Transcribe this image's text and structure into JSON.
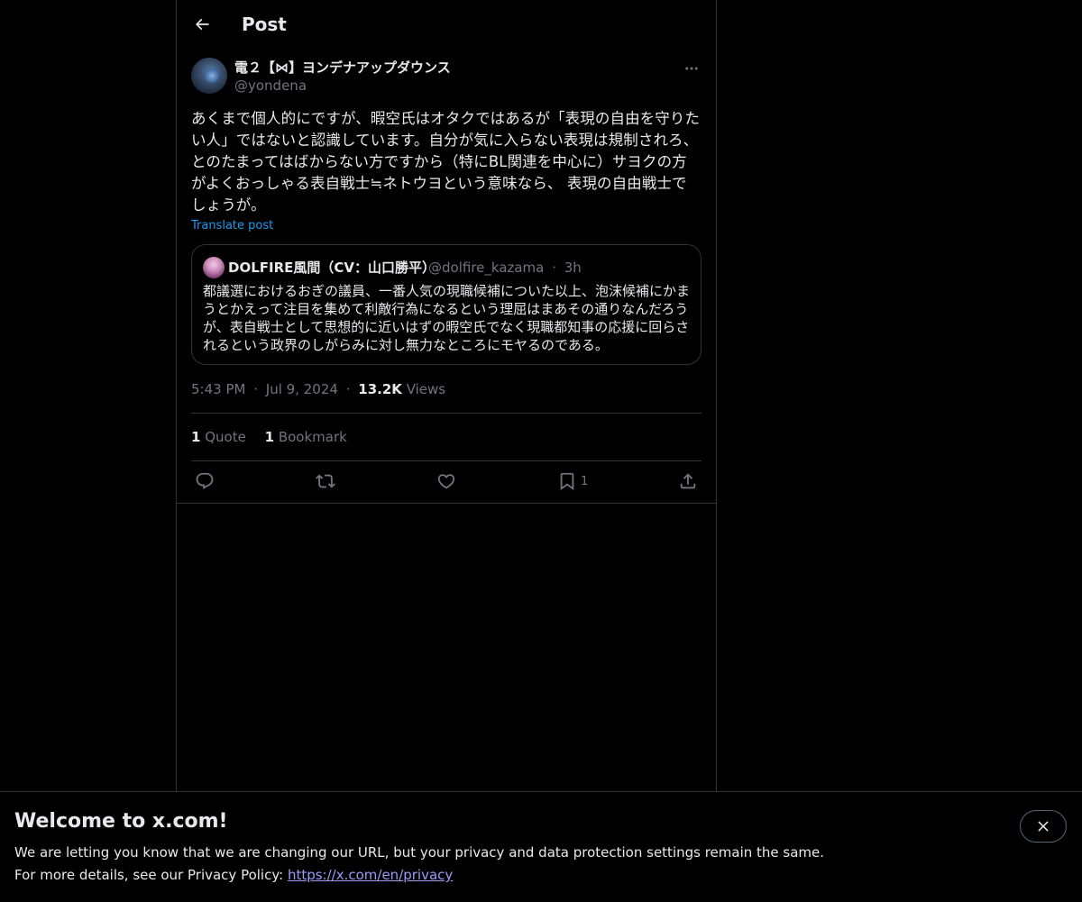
{
  "header": {
    "title": "Post"
  },
  "post": {
    "author_name": "電２【⋈】ヨンデナアップダウンス",
    "author_handle": "@yondena",
    "text": "あくまで個人的にですが、暇空氏はオタクではあるが「表現の自由を守りたい人」ではないと認識しています。自分が気に入らない表現は規制されろ、とのたまってはばからない方ですから（特にBL関連を中心に）サヨクの方がよくおっしゃる表自戦士≒ネトウヨという意味なら、 表現の自由戦士でしょうが。",
    "translate_label": "Translate post",
    "time": "5:43 PM",
    "date": "Jul 9, 2024",
    "views_count": "13.2K",
    "views_label": "Views",
    "dot": "·"
  },
  "quote": {
    "author_name": "DOLFIRE風間（CV：山口勝平）",
    "author_handle": "@dolfire_kazama",
    "age": "3h",
    "dot": "·",
    "text": "都議選におけるおぎの議員、一番人気の現職候補についた以上、泡沫候補にかまうとかえって注目を集めて利敵行為になるという理屈はまあその通りなんだろうが、表自戦士として思想的に近いはずの暇空氏でなく現職都知事の応援に回らされるという政界のしがらみに対し無力なところにモヤるのである。"
  },
  "stats": {
    "quote_count": "1",
    "quote_label": "Quote",
    "bookmark_count": "1",
    "bookmark_label": "Bookmark"
  },
  "actions": {
    "bookmark_count": "1",
    "icons": [
      "reply-icon",
      "repost-icon",
      "like-icon",
      "bookmark-icon",
      "share-icon"
    ]
  },
  "banner": {
    "title": "Welcome to x.com!",
    "line1": "We are letting you know that we are changing our URL, but your privacy and data protection settings remain the same.",
    "line2_prefix": "For more details, see our Privacy Policy: ",
    "link": "https://x.com/en/privacy"
  },
  "colors": {
    "background": "#000000",
    "text": "#e7e9ea",
    "muted": "#71767b",
    "accent": "#1d9bf0",
    "border": "#2f3336",
    "link": "#9b9cf8"
  }
}
